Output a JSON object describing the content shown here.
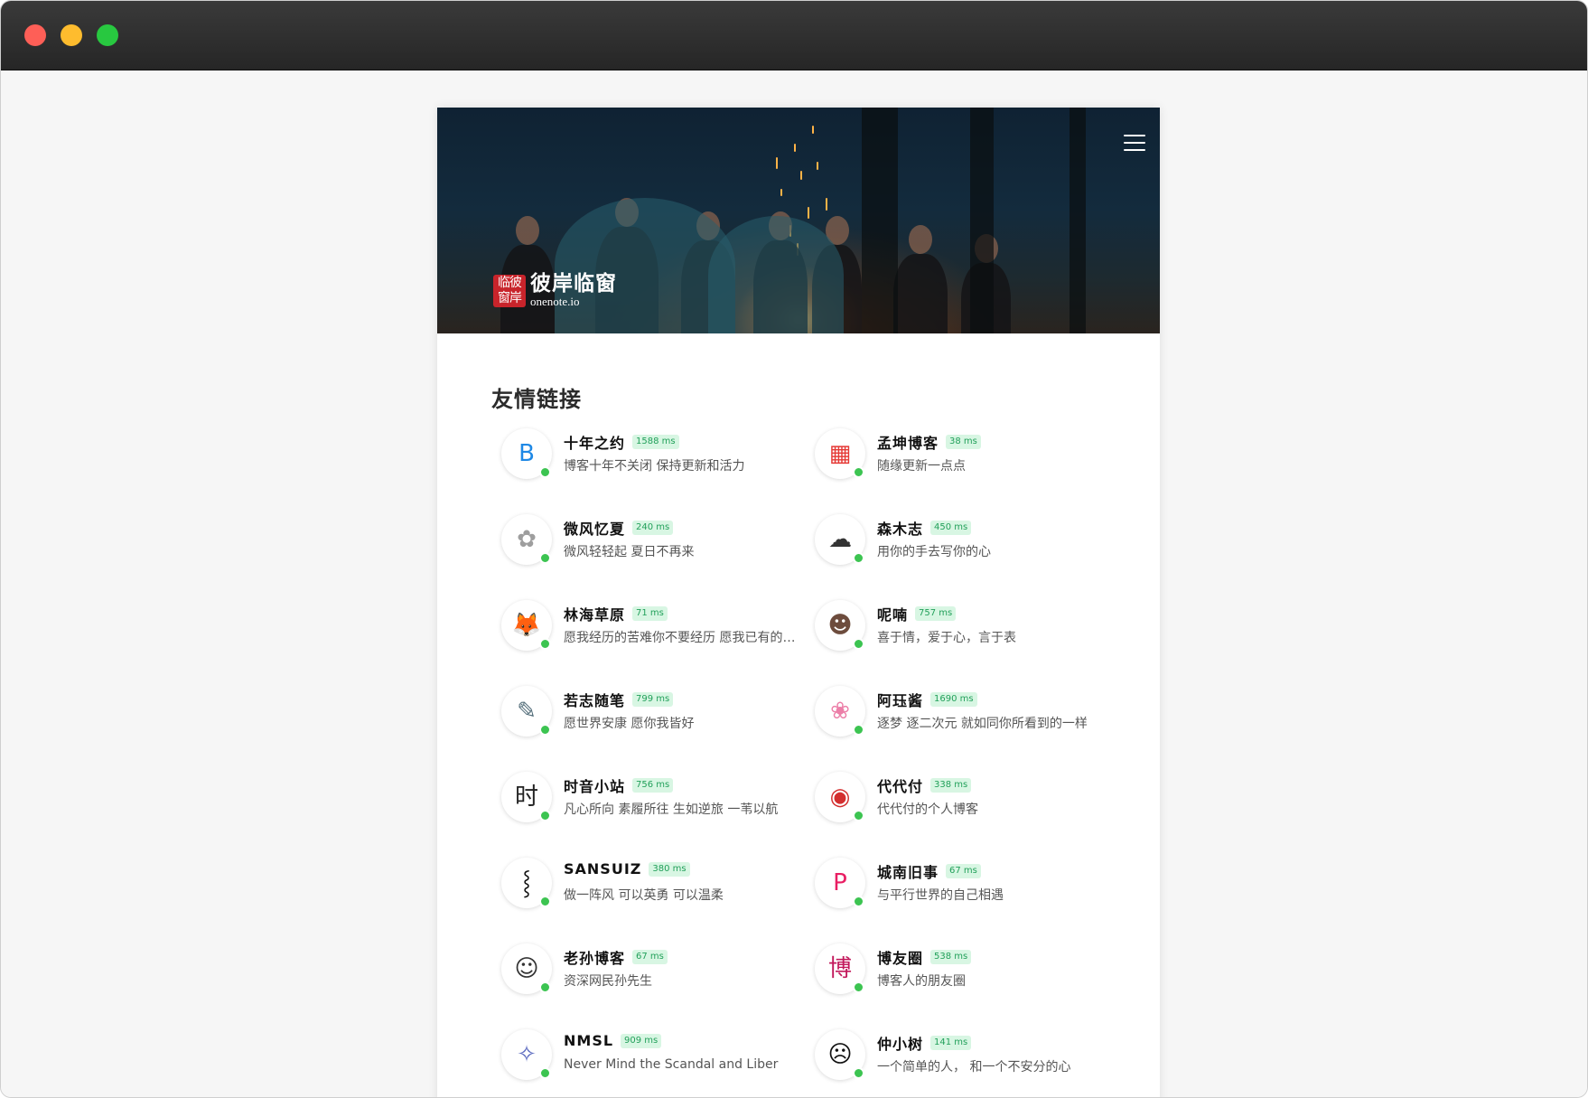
{
  "header": {
    "logo_seal": "临彼窗岸",
    "logo_name": "彼岸临窗",
    "logo_domain": "onenote.io"
  },
  "page": {
    "title": "友情链接"
  },
  "links": [
    {
      "name": "十年之约",
      "ping": "1588 ms",
      "desc": "博客十年不关闭 保持更新和活力",
      "avatar_icon": "blog-b-icon",
      "color": "#1e88e5",
      "glyph": "B"
    },
    {
      "name": "孟坤博客",
      "ping": "38 ms",
      "desc": "随缘更新一点点",
      "avatar_icon": "four-squares-icon",
      "color": "#e53935",
      "glyph": "▦"
    },
    {
      "name": "微风忆夏",
      "ping": "240 ms",
      "desc": "微风轻轻起 夏日不再来",
      "avatar_icon": "anime-girl-sketch-icon",
      "color": "#9e9e9e",
      "glyph": "✿"
    },
    {
      "name": "森木志",
      "ping": "450 ms",
      "desc": "用你的手去写你的心",
      "avatar_icon": "landscape-sketch-icon",
      "color": "#333333",
      "glyph": "☁"
    },
    {
      "name": "林海草原",
      "ping": "71 ms",
      "desc": "愿我经历的苦难你不要经历 愿我已有的幸福你触手可及",
      "avatar_icon": "fox-icon",
      "color": "#b8742a",
      "glyph": "🦊"
    },
    {
      "name": "呢喃",
      "ping": "757 ms",
      "desc": "喜于情，爱于心，言于表",
      "avatar_icon": "portrait-photo-icon",
      "color": "#6d4c3d",
      "glyph": "☻"
    },
    {
      "name": "若志随笔",
      "ping": "799 ms",
      "desc": "愿世界安康 愿你我皆好",
      "avatar_icon": "line-art-icon",
      "color": "#546e7a",
      "glyph": "✎"
    },
    {
      "name": "阿珏酱",
      "ping": "1690 ms",
      "desc": "逐梦 逐二次元 就如同你所看到的一样",
      "avatar_icon": "pink-anime-girl-icon",
      "color": "#ec7fa8",
      "glyph": "❀"
    },
    {
      "name": "时音小站",
      "ping": "756 ms",
      "desc": "凡心所向 素履所往 生如逆旅 一苇以航",
      "avatar_icon": "calligraphy-icon",
      "color": "#222222",
      "glyph": "时"
    },
    {
      "name": "代代付",
      "ping": "338 ms",
      "desc": "代代付的个人博客",
      "avatar_icon": "anime-character-icon",
      "color": "#d32f2f",
      "glyph": "◉"
    },
    {
      "name": "SANSUIZ",
      "ping": "380 ms",
      "desc": "做一阵风 可以英勇 可以温柔",
      "avatar_icon": "brush-stroke-icon",
      "color": "#111111",
      "glyph": "⸾"
    },
    {
      "name": "城南旧事",
      "ping": "67 ms",
      "desc": "与平行世界的自己相遇",
      "avatar_icon": "letter-p-icon",
      "color": "#e91e63",
      "glyph": "P"
    },
    {
      "name": "老孙博客",
      "ping": "67 ms",
      "desc": "资深网民孙先生",
      "avatar_icon": "cartoon-boy-icon",
      "color": "#333333",
      "glyph": "☺"
    },
    {
      "name": "博友圈",
      "ping": "538 ms",
      "desc": "博客人的朋友圈",
      "avatar_icon": "bo-character-icon",
      "color": "#c2185b",
      "glyph": "博"
    },
    {
      "name": "NMSL",
      "ping": "909 ms",
      "desc": "Never Mind the Scandal and Liber",
      "avatar_icon": "blue-anime-girl-icon",
      "color": "#5c6bc0",
      "glyph": "✧"
    },
    {
      "name": "仲小树",
      "ping": "141 ms",
      "desc": "一个简单的人， 和一个不安分的心",
      "avatar_icon": "doodle-face-icon",
      "color": "#111111",
      "glyph": "☹"
    }
  ]
}
